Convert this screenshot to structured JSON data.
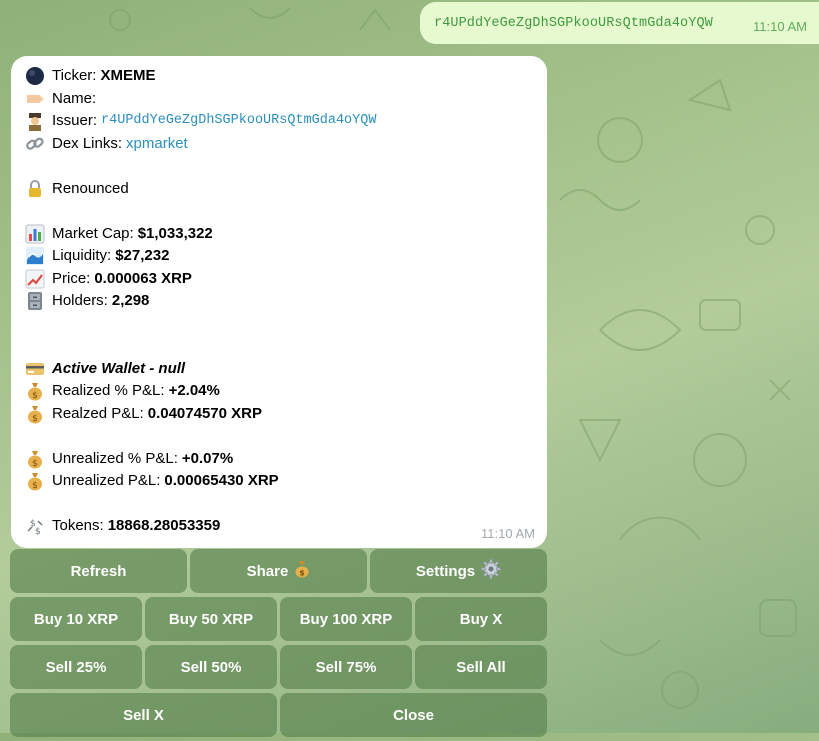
{
  "outgoing": {
    "text": "r4UPddYeGeZgDhSGPkooURsQtmGda4oYQW",
    "time": "11:10 AM"
  },
  "bot_message": {
    "ticker_label": "Ticker:",
    "ticker_value": "XMEME",
    "name_label": "Name:",
    "name_value": "",
    "issuer_label": "Issuer:",
    "issuer_value": "r4UPddYeGeZgDhSGPkooURsQtmGda4oYQW",
    "dex_label": "Dex Links:",
    "dex_link": "xpmarket",
    "renounced": "Renounced",
    "market_cap_label": "Market Cap:",
    "market_cap_value": "$1,033,322",
    "liquidity_label": "Liquidity:",
    "liquidity_value": "$27,232",
    "price_label": "Price:",
    "price_value": "0.000063 XRP",
    "holders_label": "Holders:",
    "holders_value": "2,298",
    "active_wallet": "Active Wallet - null",
    "realized_pct_label": "Realized % P&L:",
    "realized_pct_value": "+2.04%",
    "realized_label": "Realzed P&L:",
    "realized_value": "0.04074570 XRP",
    "unrealized_pct_label": "Unrealized % P&L:",
    "unrealized_pct_value": "+0.07%",
    "unrealized_label": "Unrealized P&L:",
    "unrealized_value": "0.00065430 XRP",
    "tokens_label": "Tokens:",
    "tokens_value": "18868.28053359",
    "time": "11:10 AM"
  },
  "icons": {
    "ticker": "black-circle-icon",
    "name": "label-tag-icon",
    "issuer": "detective-icon",
    "dex": "link-icon",
    "renounced": "lock-icon",
    "market_cap": "bar-chart-icon",
    "liquidity": "water-wave-icon",
    "price": "chart-up-icon",
    "holders": "file-cabinet-icon",
    "wallet": "credit-card-icon",
    "money": "money-bag-icon",
    "tokens": "currency-exchange-icon",
    "settings": "gear-icon"
  },
  "keyboard": {
    "refresh": "Refresh",
    "share": "Share",
    "settings": "Settings",
    "buy_10": "Buy 10 XRP",
    "buy_50": "Buy 50 XRP",
    "buy_100": "Buy 100 XRP",
    "buy_x": "Buy X",
    "sell_25": "Sell 25%",
    "sell_50": "Sell 50%",
    "sell_75": "Sell 75%",
    "sell_all": "Sell All",
    "sell_x": "Sell X",
    "close": "Close"
  },
  "colors": {
    "link": "#2a8fbd",
    "outgoing_bubble": "#e7f9cf",
    "outgoing_text": "#3f9a3f",
    "button": "#56804c"
  }
}
